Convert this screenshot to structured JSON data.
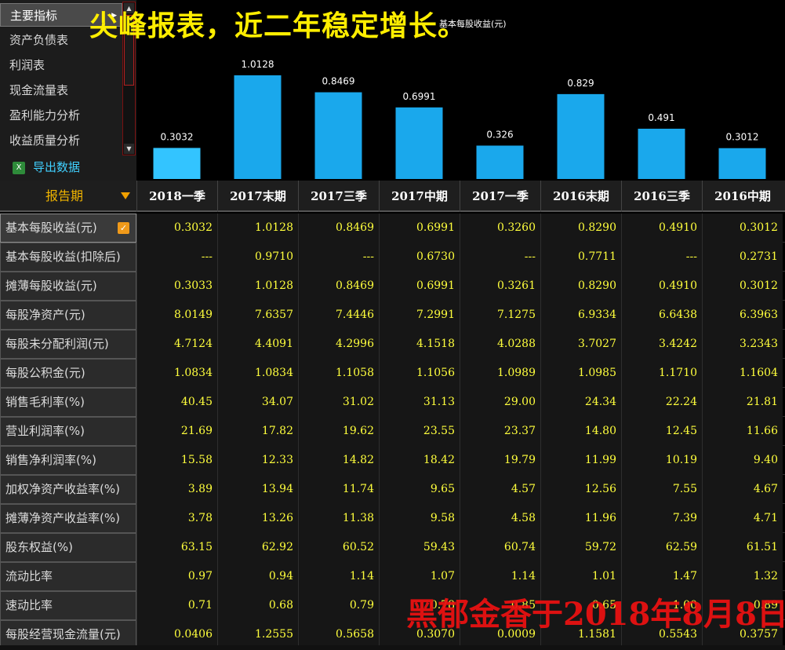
{
  "menu": {
    "items": [
      "主要指标",
      "资产负债表",
      "利润表",
      "现金流量表",
      "盈利能力分析",
      "收益质量分析"
    ],
    "export_label": "导出数据"
  },
  "overlay_title": "尖峰报表，近二年稳定增长。",
  "chart_data": {
    "type": "bar",
    "title": "基本每股收益(元)",
    "categories": [
      "2018一季",
      "2017末期",
      "2017三季",
      "2017中期",
      "2017一季",
      "2016末期",
      "2016三季",
      "2016中期"
    ],
    "values": [
      0.3032,
      1.0128,
      0.8469,
      0.6991,
      0.326,
      0.829,
      0.491,
      0.3012
    ],
    "value_labels": [
      "0.3032",
      "1.0128",
      "0.8469",
      "0.6991",
      "0.326",
      "0.829",
      "0.491",
      "0.3012"
    ],
    "ylim": [
      0,
      1.15
    ],
    "colors": {
      "bar": "#1aa8ec",
      "label": "#ffffff",
      "first_bar": "#33c4ff"
    }
  },
  "table": {
    "corner_label": "报告期",
    "columns": [
      "2018一季",
      "2017末期",
      "2017三季",
      "2017中期",
      "2017一季",
      "2016末期",
      "2016三季",
      "2016中期"
    ],
    "rows": [
      {
        "label": "基本每股收益(元)",
        "selected": true,
        "values": [
          "0.3032",
          "1.0128",
          "0.8469",
          "0.6991",
          "0.3260",
          "0.8290",
          "0.4910",
          "0.3012"
        ]
      },
      {
        "label": "基本每股收益(扣除后)",
        "values": [
          "---",
          "0.9710",
          "---",
          "0.6730",
          "---",
          "0.7711",
          "---",
          "0.2731"
        ]
      },
      {
        "label": "摊薄每股收益(元)",
        "values": [
          "0.3033",
          "1.0128",
          "0.8469",
          "0.6991",
          "0.3261",
          "0.8290",
          "0.4910",
          "0.3012"
        ]
      },
      {
        "label": "每股净资产(元)",
        "values": [
          "8.0149",
          "7.6357",
          "7.4446",
          "7.2991",
          "7.1275",
          "6.9334",
          "6.6438",
          "6.3963"
        ]
      },
      {
        "label": "每股未分配利润(元)",
        "values": [
          "4.7124",
          "4.4091",
          "4.2996",
          "4.1518",
          "4.0288",
          "3.7027",
          "3.4242",
          "3.2343"
        ]
      },
      {
        "label": "每股公积金(元)",
        "values": [
          "1.0834",
          "1.0834",
          "1.1058",
          "1.1056",
          "1.0989",
          "1.0985",
          "1.1710",
          "1.1604"
        ]
      },
      {
        "label": "销售毛利率(%)",
        "values": [
          "40.45",
          "34.07",
          "31.02",
          "31.13",
          "29.00",
          "24.34",
          "22.24",
          "21.81"
        ]
      },
      {
        "label": "营业利润率(%)",
        "values": [
          "21.69",
          "17.82",
          "19.62",
          "23.55",
          "23.37",
          "14.80",
          "12.45",
          "11.66"
        ]
      },
      {
        "label": "销售净利润率(%)",
        "values": [
          "15.58",
          "12.33",
          "14.82",
          "18.42",
          "19.79",
          "11.99",
          "10.19",
          "9.40"
        ]
      },
      {
        "label": "加权净资产收益率(%)",
        "values": [
          "3.89",
          "13.94",
          "11.74",
          "9.65",
          "4.57",
          "12.56",
          "7.55",
          "4.67"
        ]
      },
      {
        "label": "摊薄净资产收益率(%)",
        "values": [
          "3.78",
          "13.26",
          "11.38",
          "9.58",
          "4.58",
          "11.96",
          "7.39",
          "4.71"
        ]
      },
      {
        "label": "股东权益(%)",
        "values": [
          "63.15",
          "62.92",
          "60.52",
          "59.43",
          "60.74",
          "59.72",
          "62.59",
          "61.51"
        ]
      },
      {
        "label": "流动比率",
        "values": [
          "0.97",
          "0.94",
          "1.14",
          "1.07",
          "1.14",
          "1.01",
          "1.47",
          "1.32"
        ]
      },
      {
        "label": "速动比率",
        "values": [
          "0.71",
          "0.68",
          "0.79",
          "0.78",
          "0.85",
          "0.65",
          "1.00",
          "0.89"
        ]
      },
      {
        "label": "每股经营现金流量(元)",
        "values": [
          "0.0406",
          "1.2555",
          "0.5658",
          "0.3070",
          "0.0009",
          "1.1581",
          "0.5543",
          "0.3757"
        ]
      }
    ]
  },
  "watermark": "黑郁金香于2018年8月8日"
}
